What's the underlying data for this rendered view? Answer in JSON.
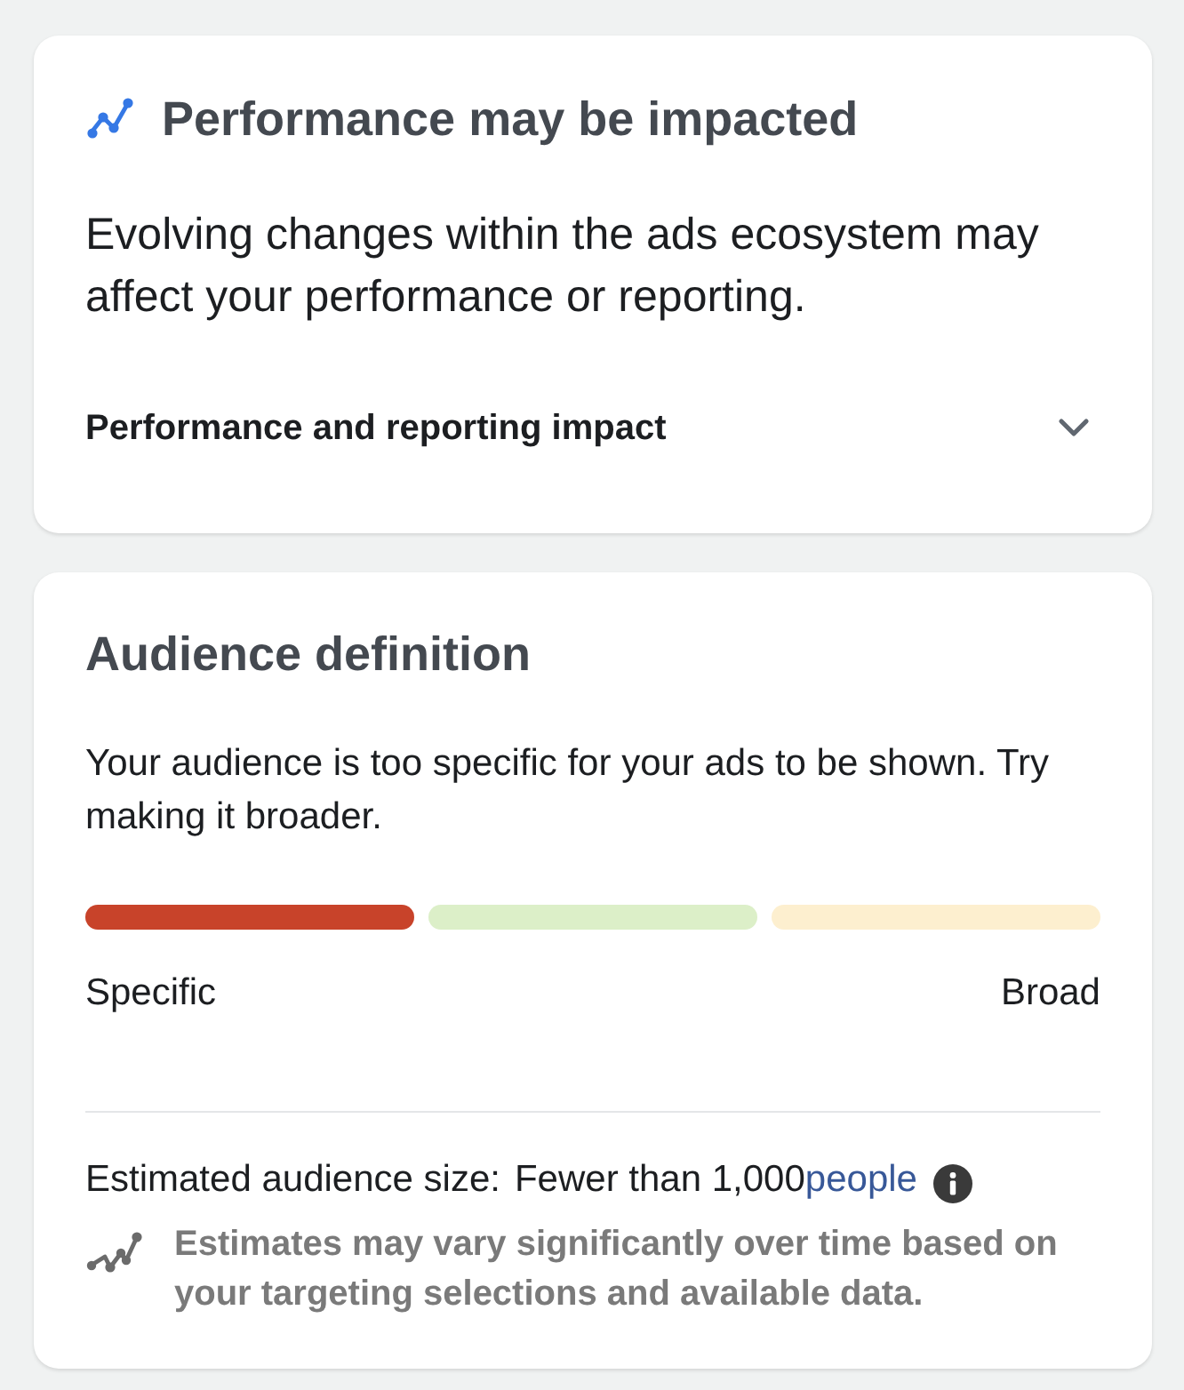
{
  "performance_card": {
    "title": "Performance may be impacted",
    "body": "Evolving changes within the ads ecosystem may affect your performance or reporting.",
    "disclosure": {
      "label": "Performance and reporting impact",
      "expanded": false
    }
  },
  "audience_card": {
    "title": "Audience definition",
    "message": "Your audience is too specific for your ads to be shown. Try making it broader.",
    "meter": {
      "segments": [
        {
          "color": "#c8432a"
        },
        {
          "color": "#dcefc8"
        },
        {
          "color": "#fdefcf"
        }
      ],
      "min_label": "Specific",
      "max_label": "Broad"
    },
    "estimate": {
      "label": "Estimated audience size:",
      "value": "Fewer than 1,000",
      "link": "people"
    },
    "note": "Estimates may vary significantly over time based on your targeting selections and available data."
  }
}
